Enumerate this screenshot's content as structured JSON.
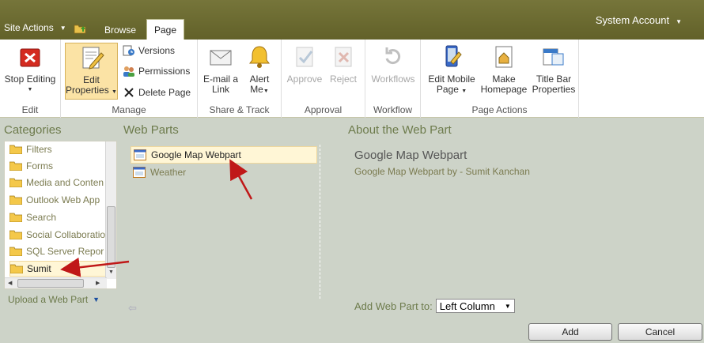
{
  "topbar": {
    "site_actions": "Site Actions",
    "tabs": [
      {
        "label": "Browse"
      },
      {
        "label": "Page"
      }
    ],
    "user": "System Account"
  },
  "ribbon": {
    "edit": {
      "stop_editing": "Stop Editing",
      "label": "Edit"
    },
    "manage": {
      "edit_properties_1": "Edit",
      "edit_properties_2": "Properties",
      "versions": "Versions",
      "permissions": "Permissions",
      "delete_page": "Delete Page",
      "label": "Manage"
    },
    "share": {
      "email_1": "E-mail a",
      "email_2": "Link",
      "alert_1": "Alert",
      "alert_2": "Me",
      "label": "Share & Track"
    },
    "approval": {
      "approve": "Approve",
      "reject": "Reject",
      "label": "Approval"
    },
    "workflow": {
      "workflows": "Workflows",
      "label": "Workflow"
    },
    "page_actions": {
      "mobile_1": "Edit Mobile",
      "mobile_2": "Page",
      "homepage_1": "Make",
      "homepage_2": "Homepage",
      "titlebar_1": "Title Bar",
      "titlebar_2": "Properties",
      "label": "Page Actions"
    }
  },
  "categories": {
    "title": "Categories",
    "items": [
      "Filters",
      "Forms",
      "Media and Conten",
      "Outlook Web App",
      "Search",
      "Social Collaboratio",
      "SQL Server Repor",
      "Sumit"
    ],
    "selected": "Sumit",
    "upload": "Upload a Web Part"
  },
  "web_parts": {
    "title": "Web Parts",
    "items": [
      "Google Map Webpart",
      "Weather"
    ],
    "selected": "Google Map Webpart"
  },
  "about": {
    "title": "About the Web Part",
    "name": "Google Map Webpart",
    "description": "Google Map Webpart by - Sumit Kanchan",
    "add_to_label": "Add Web Part to:",
    "zone": "Left Column"
  },
  "buttons": {
    "add": "Add",
    "cancel": "Cancel"
  },
  "colors": {
    "accent": "#6b6a2e",
    "selection": "#fff6d6",
    "arrow": "#c01818"
  }
}
